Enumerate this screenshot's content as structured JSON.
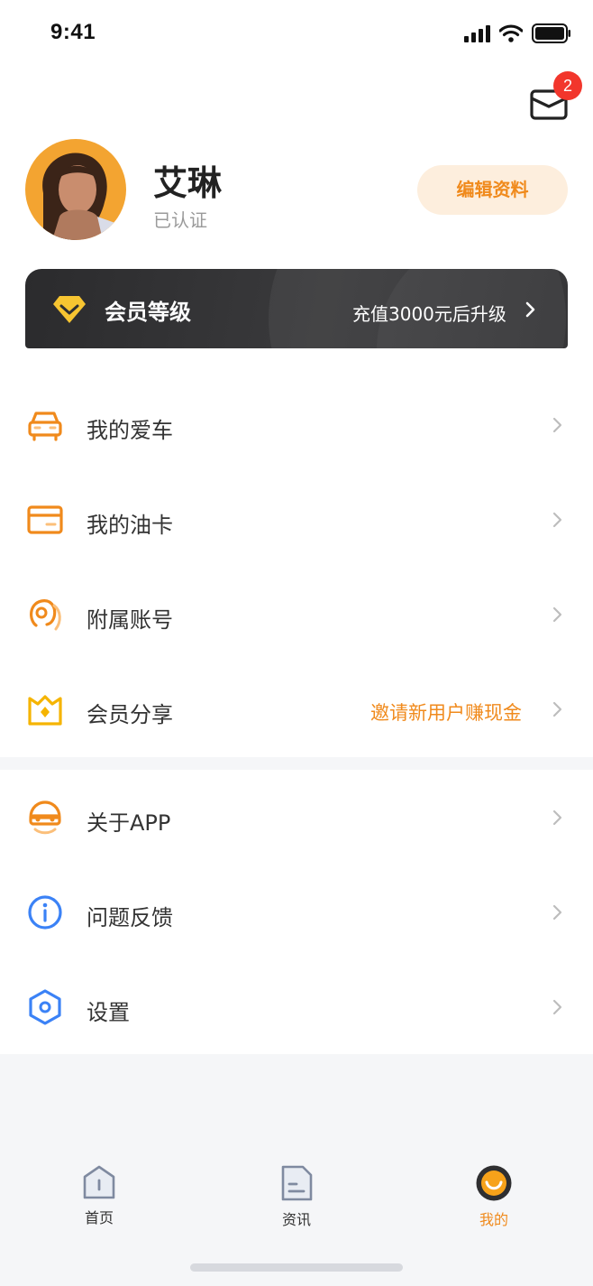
{
  "status_bar": {
    "time": "9:41"
  },
  "header": {
    "unread_count": "2"
  },
  "profile": {
    "name": "艾琳",
    "status": "已认证",
    "edit_label": "编辑资料"
  },
  "vip": {
    "title": "会员等级",
    "desc": "充值3000元后升级"
  },
  "menu": [
    {
      "label": "我的爱车",
      "icon": "car-icon"
    },
    {
      "label": "我的油卡",
      "icon": "card-icon"
    },
    {
      "label": "附属账号",
      "icon": "sub-account-icon"
    },
    {
      "label": "会员分享",
      "icon": "share-icon",
      "right_text": "邀请新用户赚现金"
    }
  ],
  "menu2": [
    {
      "label": "关于APP",
      "icon": "about-icon"
    },
    {
      "label": "问题反馈",
      "icon": "info-icon"
    },
    {
      "label": "设置",
      "icon": "settings-icon"
    }
  ],
  "tabs": [
    {
      "label": "首页",
      "icon": "home-icon"
    },
    {
      "label": "资讯",
      "icon": "news-icon"
    },
    {
      "label": "我的",
      "icon": "profile-icon",
      "active": true
    }
  ],
  "colors": {
    "accent": "#f08a1c",
    "blue": "#3b82f6",
    "badge": "#f2362c",
    "vip_bg": "#2f2f31"
  }
}
